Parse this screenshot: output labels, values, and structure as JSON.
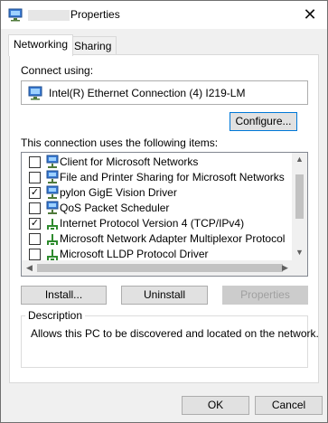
{
  "window": {
    "title": "Properties"
  },
  "tabs": [
    {
      "label": "Networking"
    },
    {
      "label": "Sharing"
    }
  ],
  "connect_using": {
    "label": "Connect using:",
    "adapter_name": "Intel(R) Ethernet Connection (4) I219-LM",
    "configure_label": "Configure..."
  },
  "items_section": {
    "label": "This connection uses the following items:",
    "items": [
      {
        "label": "Client for Microsoft Networks",
        "checked": false,
        "icon": "network-client-icon"
      },
      {
        "label": "File and Printer Sharing for Microsoft Networks",
        "checked": false,
        "icon": "network-client-icon"
      },
      {
        "label": "pylon GigE Vision Driver",
        "checked": true,
        "icon": "network-client-icon"
      },
      {
        "label": "QoS Packet Scheduler",
        "checked": false,
        "icon": "network-client-icon"
      },
      {
        "label": "Internet Protocol Version 4 (TCP/IPv4)",
        "checked": true,
        "icon": "protocol-icon"
      },
      {
        "label": "Microsoft Network Adapter Multiplexor Protocol",
        "checked": false,
        "icon": "protocol-icon"
      },
      {
        "label": "Microsoft LLDP Protocol Driver",
        "checked": false,
        "icon": "protocol-icon"
      }
    ]
  },
  "actions": {
    "install_label": "Install...",
    "uninstall_label": "Uninstall",
    "properties_label": "Properties"
  },
  "description": {
    "legend": "Description",
    "text": "Allows this PC to be discovered and located on the network."
  },
  "footer": {
    "ok_label": "OK",
    "cancel_label": "Cancel"
  },
  "colors": {
    "focus_blue": "#0078d7",
    "window_bg": "#f0f0f0",
    "button_bg": "#e1e1e1"
  }
}
